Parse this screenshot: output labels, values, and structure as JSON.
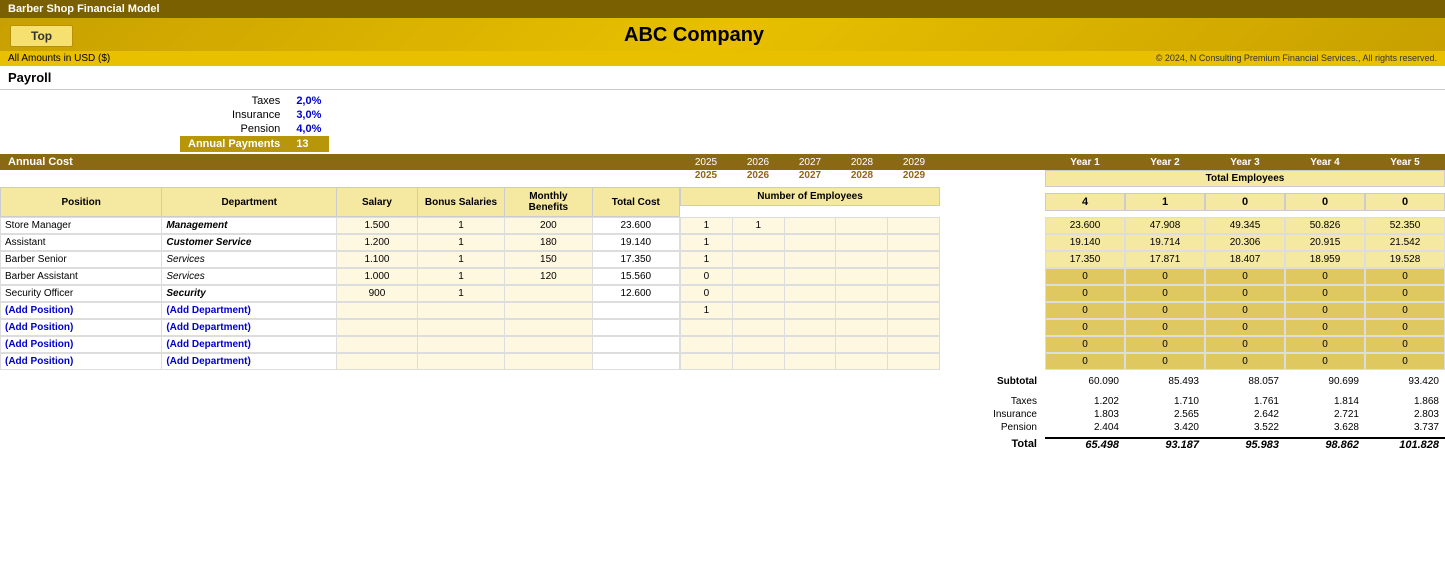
{
  "app": {
    "title": "Barber Shop Financial Model",
    "company": "ABC Company",
    "amounts_label": "All Amounts in  USD ($)",
    "copyright": "© 2024, N Consulting Premium Financial Services., All rights reserved."
  },
  "top_button": "Top",
  "section": "Payroll",
  "rates": {
    "taxes_label": "Taxes",
    "taxes_value": "2,0%",
    "insurance_label": "Insurance",
    "insurance_value": "3,0%",
    "pension_label": "Pension",
    "pension_value": "4,0%",
    "annual_payments_label": "Annual Payments",
    "annual_payments_value": "13"
  },
  "col_headers": {
    "annual_cost": "Annual Cost",
    "years": [
      "2025",
      "2026",
      "2027",
      "2028",
      "2029"
    ]
  },
  "table_headers": {
    "position": "Position",
    "department": "Department",
    "salary": "Salary",
    "bonus_salaries": "Bonus Salaries",
    "monthly_benefits": "Monthly Benefits",
    "total_cost": "Total Cost",
    "number_of_employees": "Number of Employees",
    "year1": "Year 1",
    "year2": "Year 2",
    "year3": "Year 3",
    "year4": "Year 4",
    "year5": "Year 5",
    "y2025": "2025",
    "y2026": "2026",
    "y2027": "2027",
    "y2028": "2028",
    "y2029": "2029",
    "total_employees": "Total Employees"
  },
  "positions": [
    {
      "name": "Store Manager",
      "dept": "Management",
      "dept_style": "bold",
      "salary": "1.500",
      "bonus": "1",
      "monthly_benefits": "200",
      "total_cost": "23.600",
      "emp_2025": "1",
      "emp_2026": "1",
      "emp_2027": "",
      "emp_2028": "",
      "emp_2029": "",
      "y1": "23.600",
      "y2": "47.908",
      "y3": "49.345",
      "y4": "50.826",
      "y5": "52.350"
    },
    {
      "name": "Assistant",
      "dept": "Customer Service",
      "dept_style": "bold",
      "salary": "1.200",
      "bonus": "1",
      "monthly_benefits": "180",
      "total_cost": "19.140",
      "emp_2025": "1",
      "emp_2026": "",
      "emp_2027": "",
      "emp_2028": "",
      "emp_2029": "",
      "y1": "19.140",
      "y2": "19.714",
      "y3": "20.306",
      "y4": "20.915",
      "y5": "21.542"
    },
    {
      "name": "Barber Senior",
      "dept": "Services",
      "dept_style": "normal",
      "salary": "1.100",
      "bonus": "1",
      "monthly_benefits": "150",
      "total_cost": "17.350",
      "emp_2025": "1",
      "emp_2026": "",
      "emp_2027": "",
      "emp_2028": "",
      "emp_2029": "",
      "y1": "17.350",
      "y2": "17.871",
      "y3": "18.407",
      "y4": "18.959",
      "y5": "19.528"
    },
    {
      "name": "Barber Assistant",
      "dept": "Services",
      "dept_style": "normal",
      "salary": "1.000",
      "bonus": "1",
      "monthly_benefits": "120",
      "total_cost": "15.560",
      "emp_2025": "0",
      "emp_2026": "",
      "emp_2027": "",
      "emp_2028": "",
      "emp_2029": "",
      "y1": "0",
      "y2": "0",
      "y3": "0",
      "y4": "0",
      "y5": "0"
    },
    {
      "name": "Security Officer",
      "dept": "Security",
      "dept_style": "bold",
      "salary": "900",
      "bonus": "1",
      "monthly_benefits": "",
      "total_cost": "12.600",
      "emp_2025": "0",
      "emp_2026": "",
      "emp_2027": "",
      "emp_2028": "",
      "emp_2029": "",
      "y1": "0",
      "y2": "0",
      "y3": "0",
      "y4": "0",
      "y5": "0"
    },
    {
      "name": "(Add Position)",
      "dept": "(Add Department)",
      "dept_style": "add",
      "salary": "",
      "bonus": "",
      "monthly_benefits": "",
      "total_cost": "",
      "emp_2025": "1",
      "emp_2026": "",
      "emp_2027": "",
      "emp_2028": "",
      "emp_2029": "",
      "y1": "0",
      "y2": "0",
      "y3": "0",
      "y4": "0",
      "y5": "0"
    },
    {
      "name": "(Add Position)",
      "dept": "(Add Department)",
      "dept_style": "add",
      "salary": "",
      "bonus": "",
      "monthly_benefits": "",
      "total_cost": "",
      "emp_2025": "",
      "emp_2026": "",
      "emp_2027": "",
      "emp_2028": "",
      "emp_2029": "",
      "y1": "0",
      "y2": "0",
      "y3": "0",
      "y4": "0",
      "y5": "0"
    },
    {
      "name": "(Add Position)",
      "dept": "(Add Department)",
      "dept_style": "add",
      "salary": "",
      "bonus": "",
      "monthly_benefits": "",
      "total_cost": "",
      "emp_2025": "",
      "emp_2026": "",
      "emp_2027": "",
      "emp_2028": "",
      "emp_2029": "",
      "y1": "0",
      "y2": "0",
      "y3": "0",
      "y4": "0",
      "y5": "0"
    },
    {
      "name": "(Add Position)",
      "dept": "(Add Department)",
      "dept_style": "add",
      "salary": "",
      "bonus": "",
      "monthly_benefits": "",
      "total_cost": "",
      "emp_2025": "",
      "emp_2026": "",
      "emp_2027": "",
      "emp_2028": "",
      "emp_2029": "",
      "y1": "0",
      "y2": "0",
      "y3": "0",
      "y4": "0",
      "y5": "0"
    }
  ],
  "total_employees": [
    "4",
    "1",
    "0",
    "0",
    "0"
  ],
  "subtotals": {
    "subtotal_label": "Subtotal",
    "vals": [
      "60.090",
      "85.493",
      "88.057",
      "90.699",
      "93.420"
    ],
    "taxes_label": "Taxes",
    "taxes_vals": [
      "1.202",
      "1.710",
      "1.761",
      "1.814",
      "1.868"
    ],
    "insurance_label": "Insurance",
    "insurance_vals": [
      "1.803",
      "2.565",
      "2.642",
      "2.721",
      "2.803"
    ],
    "pension_label": "Pension",
    "pension_vals": [
      "2.404",
      "3.420",
      "3.522",
      "3.628",
      "3.737"
    ],
    "total_label": "Total",
    "total_vals": [
      "65.498",
      "93.187",
      "95.983",
      "98.862",
      "101.828"
    ]
  }
}
